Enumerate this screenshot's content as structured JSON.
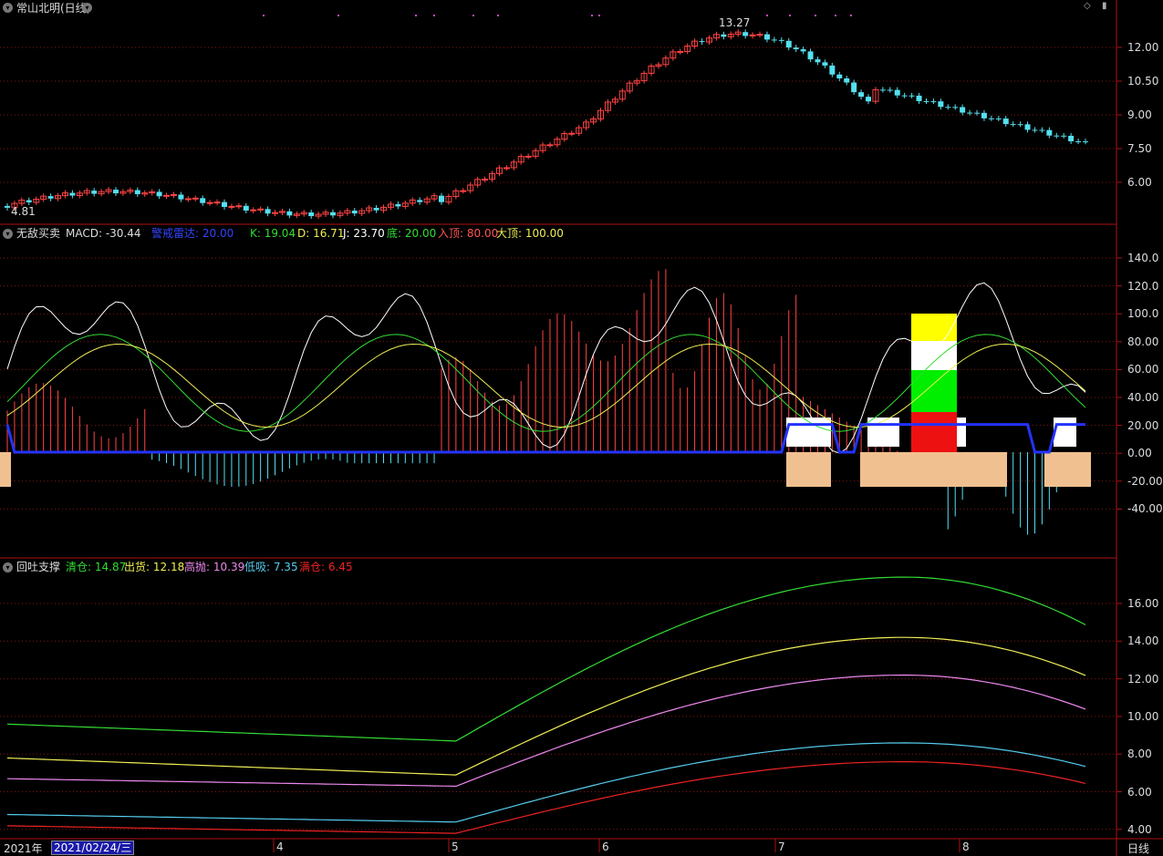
{
  "main": {
    "title": "常山北明(日线)",
    "high_label": "13.27",
    "low_label": "4.81",
    "yticks": [
      "12.00",
      "10.50",
      "9.00",
      "7.50",
      "6.00"
    ]
  },
  "sub1": {
    "name": "无敌买卖",
    "macd": "MACD: -30.44",
    "warn": "警戒雷达: 20.00",
    "k": "K: 19.04",
    "d": "D: 16.71",
    "j": "J: 23.70",
    "di": "底: 20.00",
    "rd": "入顶: 80.00",
    "dd": "大顶: 100.00",
    "yticks": [
      "140.0",
      "120.0",
      "100.0",
      "80.00",
      "60.00",
      "40.00",
      "20.00",
      "0.00",
      "-20.00",
      "-40.00"
    ]
  },
  "sub2": {
    "name": "回吐支撑",
    "qc": "清仓: 14.87",
    "ch": "出货: 12.18",
    "gp": "高抛: 10.39",
    "dx": "低吸: 7.35",
    "bc": "满仓: 6.45",
    "yticks": [
      "16.00",
      "14.00",
      "12.00",
      "10.00",
      "8.00",
      "6.00",
      "4.00"
    ]
  },
  "xaxis": {
    "year": "2021年",
    "date": "2021/02/24/三",
    "months": [
      "4",
      "5",
      "6",
      "7",
      "8"
    ],
    "period": "日线"
  },
  "colors": {
    "up": "#ff4444",
    "down": "#55e0f0",
    "qc": "#33dd33",
    "ch": "#eeee55",
    "gp": "#ee88ee",
    "dx": "#55ccee",
    "bc": "#ee2222",
    "blue": "#2233ff"
  }
}
